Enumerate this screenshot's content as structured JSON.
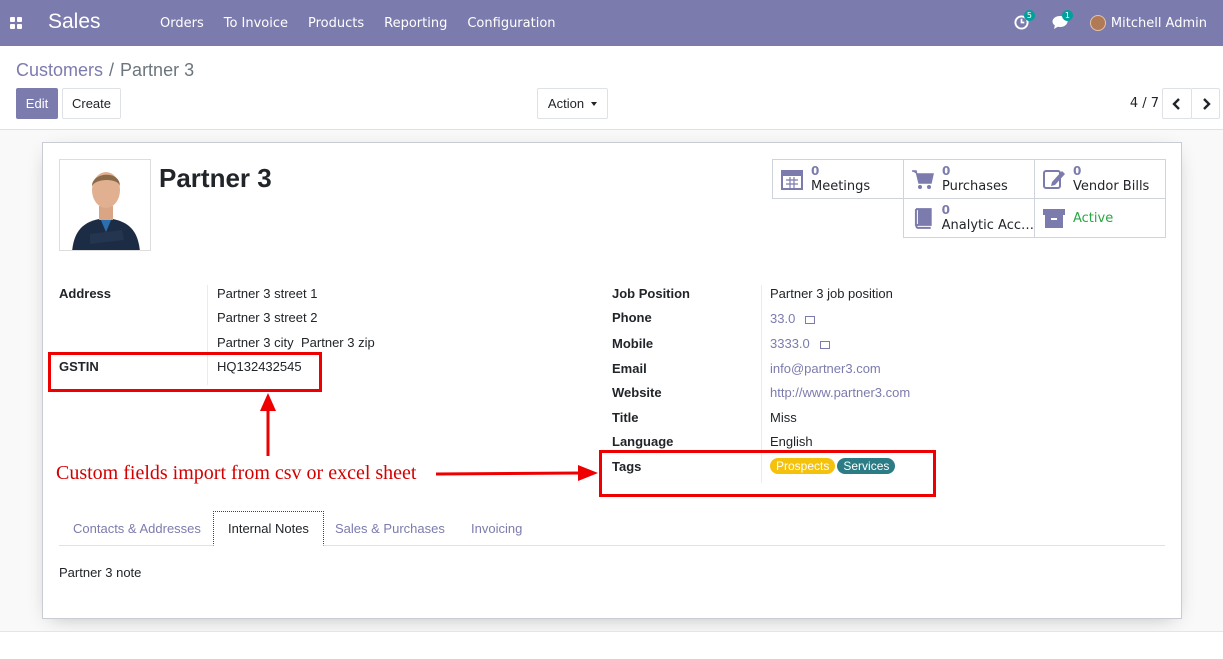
{
  "navbar": {
    "brand": "Sales",
    "menu": [
      "Orders",
      "To Invoice",
      "Products",
      "Reporting",
      "Configuration"
    ],
    "activity_count": "5",
    "messages_count": "1",
    "user_name": "Mitchell Admin"
  },
  "breadcrumb": {
    "parent": "Customers",
    "separator": "/",
    "current": "Partner 3"
  },
  "buttons": {
    "edit": "Edit",
    "create": "Create",
    "action": "Action"
  },
  "pager": {
    "text": "4 / 7"
  },
  "partner": {
    "name": "Partner 3"
  },
  "smart_buttons": {
    "meetings": {
      "count": "0",
      "label": "Meetings"
    },
    "purchases": {
      "count": "0",
      "label": "Purchases"
    },
    "vendor_bills": {
      "count": "0",
      "label": "Vendor Bills"
    },
    "analytic": {
      "count": "0",
      "label": "Analytic Acc…"
    },
    "active": {
      "label": "Active"
    }
  },
  "left_fields": {
    "address_label": "Address",
    "street1": "Partner 3 street 1",
    "street2": "Partner 3 street 2",
    "city": "Partner 3 city",
    "zip": "Partner 3 zip",
    "gstin_label": "GSTIN",
    "gstin": "HQ132432545"
  },
  "right_fields": {
    "job_label": "Job Position",
    "job": "Partner 3 job position",
    "phone_label": "Phone",
    "phone": "33.0",
    "mobile_label": "Mobile",
    "mobile": "3333.0",
    "email_label": "Email",
    "email": "info@partner3.com",
    "website_label": "Website",
    "website": "http://www.partner3.com",
    "title_label": "Title",
    "title": "Miss",
    "language_label": "Language",
    "language": "English",
    "tags_label": "Tags",
    "tags": [
      {
        "label": "Prospects",
        "color": "#f4c20d"
      },
      {
        "label": "Services",
        "color": "#2c7c86"
      }
    ]
  },
  "tabs": [
    "Contacts & Addresses",
    "Internal Notes",
    "Sales & Purchases",
    "Invoicing"
  ],
  "note": "Partner 3 note",
  "annotation": {
    "text": "Custom fields import from csv or excel sheet",
    "color": "#e00000"
  },
  "colors": {
    "brand": "#7c7bad",
    "active_green": "#28a745"
  }
}
